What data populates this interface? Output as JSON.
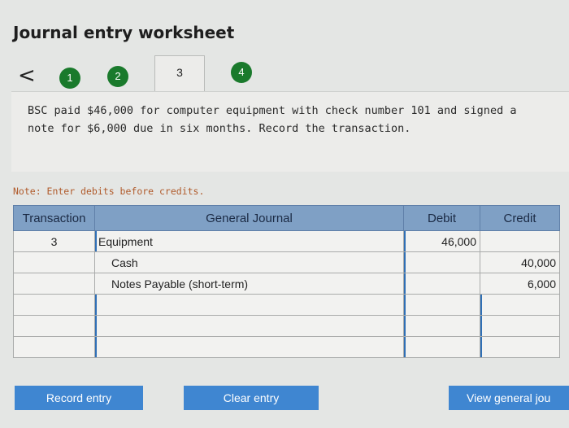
{
  "header": {
    "title": "Journal entry worksheet",
    "back_glyph": "<"
  },
  "steps": [
    "1",
    "2",
    "3",
    "4"
  ],
  "problem": {
    "text": "BSC paid $46,000 for computer equipment with check number 101 and signed a note for $6,000 due in six months. Record the transaction."
  },
  "note": "Note: Enter debits before credits.",
  "table": {
    "headers": {
      "transaction": "Transaction",
      "general_journal": "General Journal",
      "debit": "Debit",
      "credit": "Credit"
    },
    "rows": [
      {
        "transaction": "3",
        "account": "Equipment",
        "debit": "46,000",
        "credit": ""
      },
      {
        "transaction": "",
        "account": "Cash",
        "debit": "",
        "credit": "40,000"
      },
      {
        "transaction": "",
        "account": "Notes Payable (short-term)",
        "debit": "",
        "credit": "6,000"
      },
      {
        "transaction": "",
        "account": "",
        "debit": "",
        "credit": ""
      },
      {
        "transaction": "",
        "account": "",
        "debit": "",
        "credit": ""
      },
      {
        "transaction": "",
        "account": "",
        "debit": "",
        "credit": ""
      }
    ]
  },
  "buttons": {
    "record": "Record entry",
    "clear": "Clear entry",
    "view": "View general jou"
  }
}
